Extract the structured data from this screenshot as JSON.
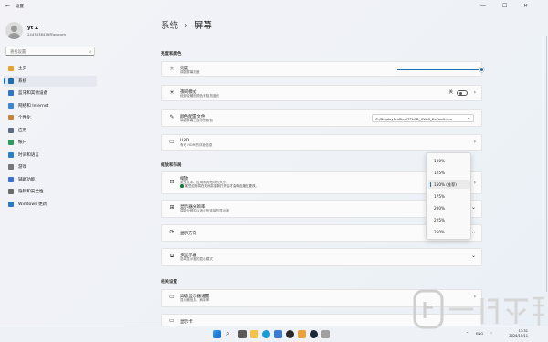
{
  "window": {
    "title": "设置",
    "back_icon": "arrow-left-icon",
    "controls": [
      "minimize-icon",
      "maximize-icon",
      "close-icon"
    ]
  },
  "user": {
    "name": "yt Z",
    "email": "2443838479@qq.com"
  },
  "search": {
    "placeholder": "查找设置"
  },
  "nav": [
    {
      "label": "主页",
      "icon": "home-icon",
      "color": "#e8a12a"
    },
    {
      "label": "系统",
      "icon": "display-icon",
      "color": "#1a6fb5",
      "active": true
    },
    {
      "label": "蓝牙和其他设备",
      "icon": "bluetooth-icon",
      "color": "#2d77c7"
    },
    {
      "label": "网络和 Internet",
      "icon": "wifi-icon",
      "color": "#3b86d1"
    },
    {
      "label": "个性化",
      "icon": "brush-icon",
      "color": "#c9823b"
    },
    {
      "label": "应用",
      "icon": "apps-icon",
      "color": "#5a6e8a"
    },
    {
      "label": "帐户",
      "icon": "account-icon",
      "color": "#2f9a5e"
    },
    {
      "label": "时间和语言",
      "icon": "clock-icon",
      "color": "#2b7fc9"
    },
    {
      "label": "游戏",
      "icon": "gamepad-icon",
      "color": "#777777"
    },
    {
      "label": "辅助功能",
      "icon": "accessibility-icon",
      "color": "#3b6fd6"
    },
    {
      "label": "隐私和安全性",
      "icon": "shield-icon",
      "color": "#6b6b6b"
    },
    {
      "label": "Windows 更新",
      "icon": "update-icon",
      "color": "#2d77c7"
    }
  ],
  "breadcrumb": {
    "root": "系统",
    "separator": "›",
    "current": "屏幕"
  },
  "sections": {
    "brightness_color": "亮度和颜色",
    "scale_layout": "缩放和布局",
    "related": "相关设置"
  },
  "cards": {
    "brightness": {
      "title": "亮度",
      "subtitle": "调整屏幕亮度",
      "value_percent": 100
    },
    "night_light": {
      "title": "夜间模式",
      "subtitle": "使用较暖的颜色来阻挡蓝光",
      "toggle_label": "关",
      "on": false
    },
    "color_profile": {
      "title": "颜色配置文件",
      "subtitle": "调整屏幕上显示的颜色",
      "value": "C:/DisplayProfiles/TPLCD_CVAS_Default.icm"
    },
    "hdr": {
      "title": "HDR",
      "subtitle": "有关 HDR 的详细信息"
    },
    "scale": {
      "title": "缩放",
      "subtitle": "更改文本、应用和其他项的大小",
      "warning": "某些应用将在关闭并重新打开后才会响应缩放更改。"
    },
    "resolution": {
      "title": "显示器分辨率",
      "subtitle": "调整分辨率以适合所连接的显示器"
    },
    "orientation": {
      "title": "显示方向"
    },
    "multi_display": {
      "title": "多显示器",
      "subtitle": "选择显示器的显示模式"
    },
    "advanced_display": {
      "title": "高级显示器设置",
      "subtitle": "显示器信息、刷新率"
    },
    "graphics": {
      "title": "显示卡"
    }
  },
  "scale_options": [
    "100%",
    "125%",
    "150% (推荐)",
    "175%",
    "200%",
    "225%",
    "250%"
  ],
  "scale_selected_index": 2,
  "taskbar": {
    "lang": "ENG",
    "time": "13:31",
    "date": "2024/10/11"
  },
  "colors": {
    "accent": "#1a6fb5",
    "window_bg": "#f3f3f7",
    "card_bg": "#fbfbfb"
  }
}
